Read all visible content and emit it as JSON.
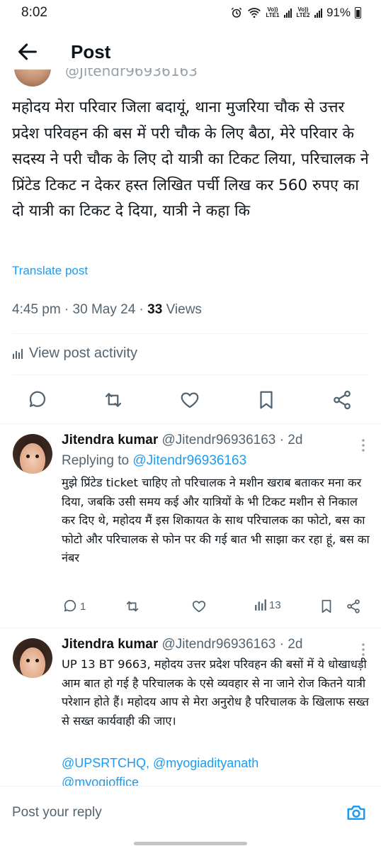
{
  "status_bar": {
    "time": "8:02",
    "sim1_label": "Vo)) LTE1",
    "sim2_label": "Vo)) LTE2",
    "battery": "91%"
  },
  "header": {
    "title": "Post",
    "back_icon": "arrow-left-icon"
  },
  "post": {
    "handle_partial": "@Jitendr96936163",
    "text": "महोदय मेरा परिवार जिला बदायूं, थाना मुजरिया चौक से उत्तर प्रदेश परिवहन की बस में परी चौक के लिए बैठा, मेरे परिवार के सदस्य ने परी चौक के लिए दो यात्री का टिकट लिया, परिचालक ने प्रिंटेड टिकट न देकर हस्त लिखित पर्ची लिख कर 560 रुपए का दो यात्री का टिकट दे दिया, यात्री ने कहा कि",
    "translate_label": "Translate post",
    "meta_prefix": "4:45 pm · 30 May 24 · ",
    "views_count": "33",
    "views_label": " Views",
    "activity_label": "View post activity"
  },
  "replies": [
    {
      "name": "Jitendra kumar",
      "handle_time": "@Jitendr96936163 · 2d",
      "replying_prefix": "Replying to ",
      "replying_handle": "@Jitendr96936163",
      "text": "मुझे प्रिंटेड ticket चाहिए तो परिचालक ने मशीन खराब बताकर मना कर दिया, जबकि उसी समय कई और यात्रियों के भी टिकट मशीन से निकाल कर दिए थे, महोदय मैं इस शिकायत के साथ परिचालक का फोटो, बस का फोटो और परिचालक से फोन पर की गई बात भी साझा कर  रहा हूं, बस का नंबर",
      "reply_count": "1",
      "views": "13"
    },
    {
      "name": "Jitendra kumar",
      "handle_time": "@Jitendr96936163 · 2d",
      "text": "UP 13 BT 9663, महोदय उत्तर प्रदेश परिवहन की बसों में ये धोखाधड़ी आम बात हो गई है परिचालक के एसे व्यवहार से ना जाने रोज कितने यात्री परेशान होते हैं। महोदय आप से मेरा अनुरोध है परिचालक के खिलाफ सख्त से सख्त कार्यवाही की जाए।",
      "mention1": "@UPSRTCHQ",
      "mention2": "@myogiadityanath",
      "mention3": "@myogioffice"
    }
  ],
  "composer": {
    "placeholder": "Post your reply",
    "camera_icon": "camera-icon"
  },
  "colors": {
    "accent": "#1d9bf0",
    "secondary_text": "#536471",
    "primary_text": "#0f1419"
  }
}
